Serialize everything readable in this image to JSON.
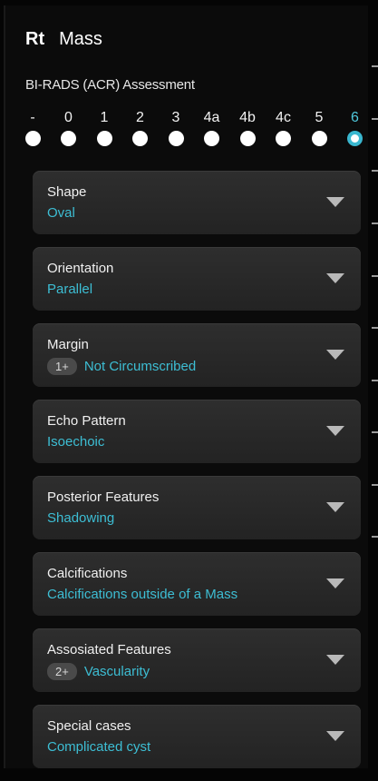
{
  "header": {
    "side": "Rt",
    "type": "Mass"
  },
  "birads": {
    "label": "BI-RADS (ACR) Assessment",
    "scale": [
      "-",
      "0",
      "1",
      "2",
      "3",
      "4a",
      "4b",
      "4c",
      "5",
      "6"
    ],
    "selected": "6"
  },
  "cards": [
    {
      "title": "Shape",
      "value": "Oval",
      "badge": ""
    },
    {
      "title": "Orientation",
      "value": "Parallel",
      "badge": ""
    },
    {
      "title": "Margin",
      "value": "Not Circumscribed",
      "badge": "1+"
    },
    {
      "title": "Echo Pattern",
      "value": "Isoechoic",
      "badge": ""
    },
    {
      "title": "Posterior Features",
      "value": "Shadowing",
      "badge": ""
    },
    {
      "title": "Calcifications",
      "value": "Calcifications outside of a Mass",
      "badge": ""
    },
    {
      "title": "Assosiated Features",
      "value": "Vascularity",
      "badge": "2+"
    },
    {
      "title": "Special cases",
      "value": "Complicated cyst",
      "badge": ""
    }
  ],
  "colors": {
    "accent": "#3dbed4",
    "background": "#0b0b0b",
    "card": "#2a2a2a"
  },
  "icons": {
    "dropdown": "chevron-down-icon"
  }
}
